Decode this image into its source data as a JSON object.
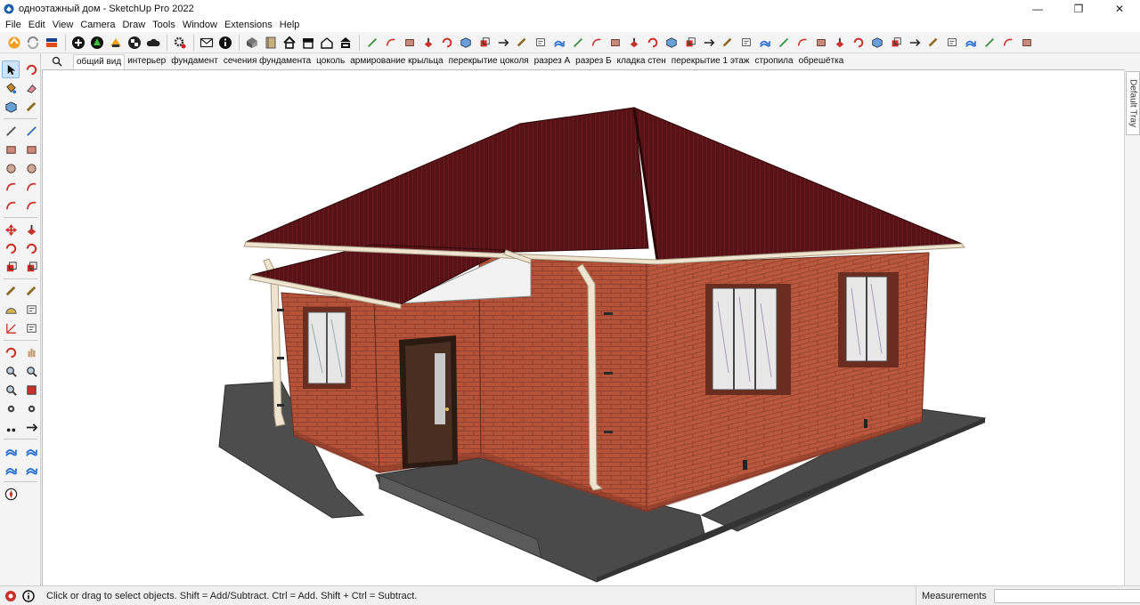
{
  "window": {
    "title": "одноэтажный дом - SketchUp Pro 2022",
    "app_icon": "sketchup-logo",
    "controls": {
      "minimize": "—",
      "restore": "❐",
      "close": "✕"
    }
  },
  "menu": [
    "File",
    "Edit",
    "View",
    "Camera",
    "Draw",
    "Tools",
    "Window",
    "Extensions",
    "Help"
  ],
  "toolbar": {
    "group1": [
      "extension-warehouse-icon",
      "sync-icon",
      "layout-icon",
      "print-icon"
    ],
    "group2": [
      "add-location-icon",
      "3d-warehouse-icon",
      "trimble-connect-icon",
      "checker-icon",
      "cloud-icon"
    ],
    "group3": [
      "settings-icon",
      "mail-icon",
      "info-icon"
    ],
    "group4": [
      "model-info-icon",
      "book-icon",
      "house-icon",
      "storefront-icon",
      "outline-house-icon",
      "roof-icon"
    ],
    "group5_count": 36
  },
  "scenes": {
    "search_icon": "magnifier-icon",
    "tabs": [
      "общий вид",
      "интерьер",
      "фундамент",
      "сечения фундамента",
      "цоколь",
      "армирование крыльца",
      "перекрытие цоколя",
      "разрез А",
      "разрез Б",
      "кладка стен",
      "перекрытие 1 этаж",
      "стропила",
      "обрешётка"
    ],
    "active": "общий вид"
  },
  "palette": [
    [
      "select-icon",
      "orbit-icon"
    ],
    [
      "paint-bucket-icon",
      "eraser-icon"
    ],
    [
      "make-component-icon",
      "tape-measure-icon"
    ],
    [
      "line-icon",
      "freehand-icon"
    ],
    [
      "rectangle-icon",
      "rotated-rectangle-icon"
    ],
    [
      "circle-icon",
      "polygon-icon"
    ],
    [
      "arc-icon",
      "two-point-arc-icon"
    ],
    [
      "three-point-arc-icon",
      "pie-icon"
    ],
    [
      "move-icon",
      "push-pull-icon"
    ],
    [
      "rotate-icon",
      "follow-me-icon"
    ],
    [
      "scale-icon",
      "offset-icon"
    ],
    [
      "tape-measure-icon",
      "dimension-icon"
    ],
    [
      "protractor-icon",
      "text-icon"
    ],
    [
      "axes-icon",
      "3d-text-icon"
    ],
    [
      "orbit-icon",
      "pan-icon"
    ],
    [
      "zoom-icon",
      "zoom-window-icon"
    ],
    [
      "zoom-extents-icon",
      "previous-view-icon"
    ],
    [
      "position-camera-icon",
      "look-around-icon"
    ],
    [
      "walk-icon",
      "section-plane-icon"
    ],
    [
      "sandbox-from-contours-icon",
      "sandbox-from-scratch-icon"
    ],
    [
      "smoove-icon",
      "stamp-icon"
    ],
    [
      "compass-icon"
    ]
  ],
  "scene3d": {
    "roof_color": "#5a1418",
    "brick_color": "#b4533a",
    "gutter_color": "#efe4cf",
    "ground_color": "#4b4b4b",
    "sky_color": "#ffffff"
  },
  "tray": {
    "label": "Default Tray"
  },
  "status": {
    "icons": [
      "geo-location-icon",
      "info-icon"
    ],
    "text": "Click or drag to select objects. Shift = Add/Subtract. Ctrl = Add. Shift + Ctrl = Subtract.",
    "measurements_label": "Measurements",
    "measurements_value": ""
  }
}
